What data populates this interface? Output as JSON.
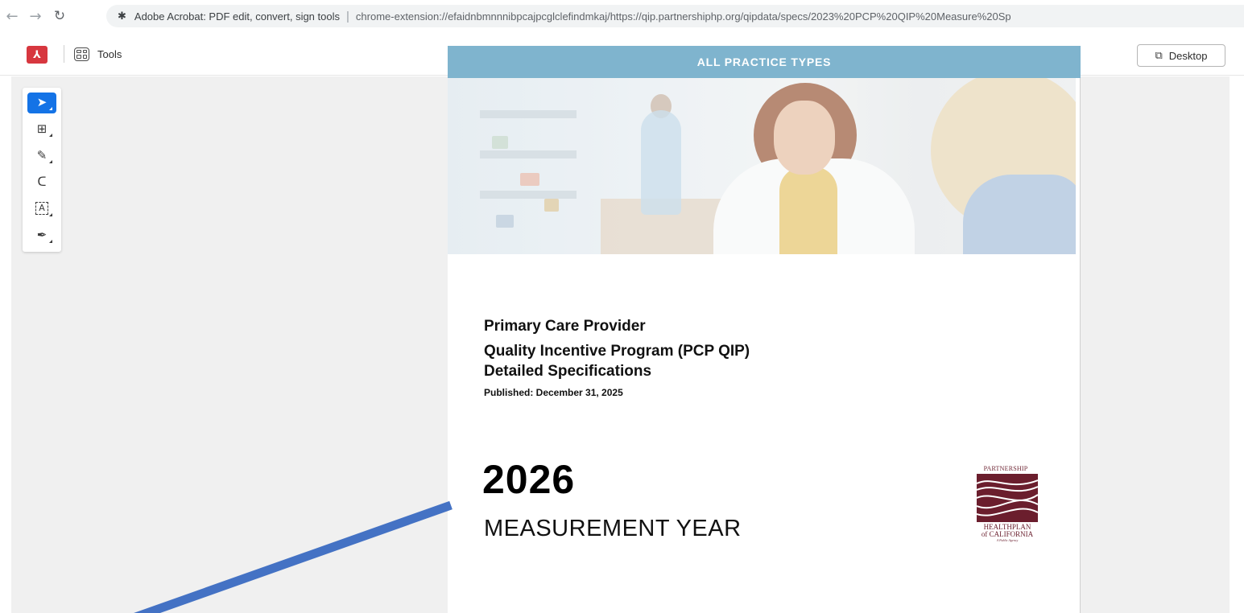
{
  "browser": {
    "back_icon": "arrow-left-icon",
    "forward_icon": "arrow-right-icon",
    "reload_icon": "reload-icon",
    "extension_icon": "puzzle-icon",
    "tab_title": "Adobe Acrobat: PDF edit, convert, sign tools",
    "separator": "|",
    "url": "chrome-extension://efaidnbmnnnibpcajpcglclefindmkaj/https://qip.partnershiphp.org/qipdata/specs/2023%20PCP%20QIP%20Measure%20Sp"
  },
  "acrobat": {
    "logo_icon": "acrobat-logo-icon",
    "tools_label": "Tools",
    "desktop_label": "Desktop",
    "brand_color": "#d7373f",
    "accent_color": "#1473e6"
  },
  "tool_rail": {
    "tools": [
      {
        "name": "select-tool",
        "icon": "cursor-arrow-icon",
        "active": true
      },
      {
        "name": "comment-tool",
        "icon": "add-comment-icon",
        "active": false
      },
      {
        "name": "highlight-tool",
        "icon": "pen-icon",
        "active": false
      },
      {
        "name": "draw-tool",
        "icon": "freeform-loop-icon",
        "active": false
      },
      {
        "name": "text-tool",
        "icon": "text-box-icon",
        "glyph": "A",
        "active": false
      },
      {
        "name": "sign-tool",
        "icon": "signature-pen-icon",
        "active": false
      }
    ]
  },
  "document": {
    "banner": "ALL PRACTICE TYPES",
    "banner_color": "#7fb4ce",
    "title_line1": "Primary Care Provider",
    "title_line2": "Quality Incentive Program (PCP QIP)",
    "title_line3": "Detailed Specifications",
    "published": "Published: December 31, 2025",
    "year": "2026",
    "measurement": "MEASUREMENT YEAR",
    "logo": {
      "top": "PARTNERSHIP",
      "bottom1": "HEALTHPLAN",
      "bottom2": "of CALIFORNIA",
      "bottom3": "A Public Agency",
      "color": "#6b1e2d"
    }
  },
  "annotation": {
    "arrow_color": "#4472c4"
  }
}
